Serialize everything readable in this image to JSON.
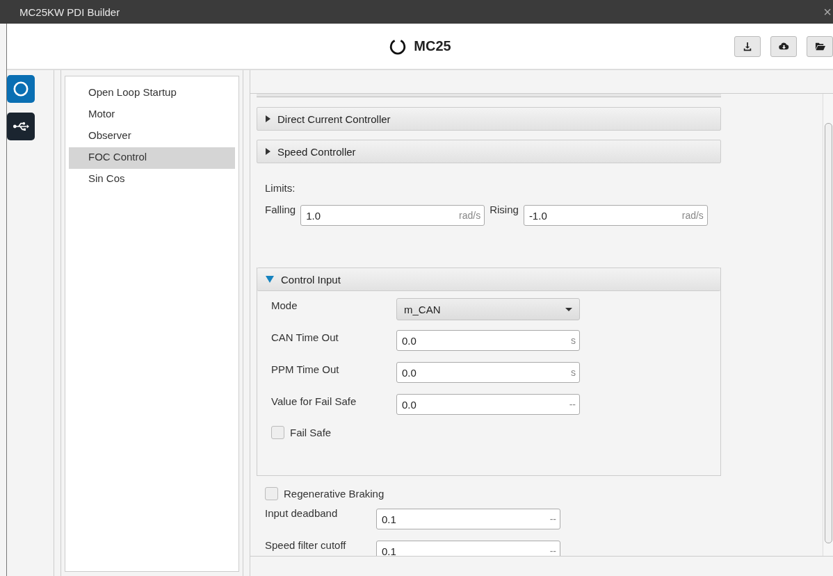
{
  "window": {
    "title": "MC25KW PDI Builder",
    "close": "×"
  },
  "header": {
    "title": "MC25"
  },
  "nav": {
    "items": [
      {
        "label": "Open Loop Startup",
        "selected": false
      },
      {
        "label": "Motor",
        "selected": false
      },
      {
        "label": "Observer",
        "selected": false
      },
      {
        "label": "FOC Control",
        "selected": true
      },
      {
        "label": "Sin Cos",
        "selected": false
      }
    ]
  },
  "sections": [
    {
      "title": "Direct Current Controller",
      "expanded": false
    },
    {
      "title": "Speed Controller",
      "expanded": false
    }
  ],
  "limits": {
    "label": "Limits:",
    "fields": [
      {
        "label": "Falling",
        "value": "1.0",
        "unit": "rad/s"
      },
      {
        "label": "Rising",
        "value": "-1.0",
        "unit": "rad/s"
      }
    ]
  },
  "control_input": {
    "title": "Control Input",
    "expanded": true,
    "rows": [
      {
        "kind": "select",
        "label": "Mode",
        "value": "m_CAN"
      },
      {
        "kind": "number",
        "label": "CAN Time Out",
        "value": "0.0",
        "unit": "s"
      },
      {
        "kind": "number",
        "label": "PPM Time Out",
        "value": "0.0",
        "unit": "s"
      },
      {
        "kind": "number",
        "label": "Value for Fail Safe",
        "value": "0.0",
        "unit": "--"
      }
    ],
    "fail_safe": {
      "label": "Fail Safe",
      "checked": false
    }
  },
  "regenerative_braking": {
    "label": "Regenerative Braking",
    "checked": false
  },
  "fields": [
    {
      "label": "Input deadband",
      "value": "0.1",
      "unit": "--"
    },
    {
      "label": "Speed filter cutoff",
      "value": "0.1",
      "unit": "--"
    }
  ]
}
